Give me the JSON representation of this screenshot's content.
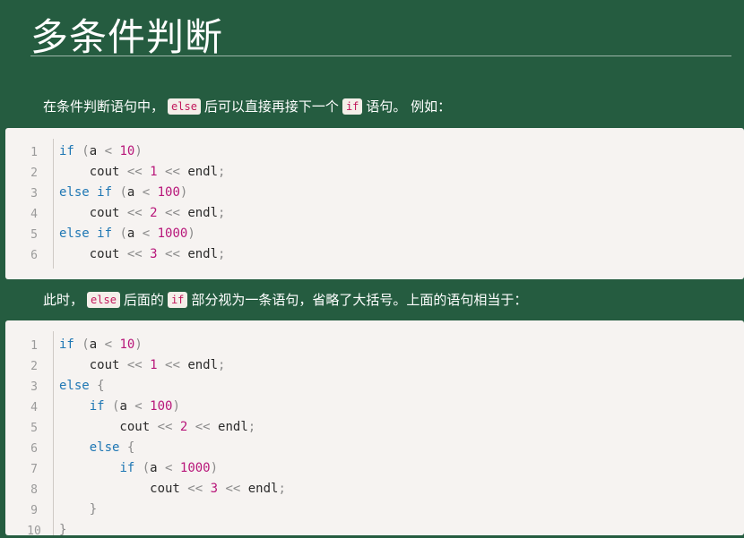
{
  "page": {
    "title": "多条件判断"
  },
  "para1": {
    "before": "在条件判断语句中，",
    "kw1": "else",
    "middle": "后可以直接再接下一个",
    "kw2": "if",
    "after": "语句。 例如："
  },
  "para2": {
    "before": "此时，",
    "kw1": "else",
    "middle": "后面的",
    "kw2": "if",
    "after": "部分视为一条语句，省略了大括号。上面的语句相当于："
  },
  "code1": {
    "line_numbers": [
      "1",
      "2",
      "3",
      "4",
      "5",
      "6"
    ],
    "lines": [
      [
        {
          "t": "if",
          "c": "k"
        },
        {
          "t": " (",
          "c": "p"
        },
        {
          "t": "a",
          "c": "t"
        },
        {
          "t": " < ",
          "c": "p"
        },
        {
          "t": "10",
          "c": "n"
        },
        {
          "t": ")",
          "c": "p"
        }
      ],
      [
        {
          "t": "    cout",
          "c": "t"
        },
        {
          "t": " << ",
          "c": "p"
        },
        {
          "t": "1",
          "c": "n"
        },
        {
          "t": " << ",
          "c": "p"
        },
        {
          "t": "endl",
          "c": "t"
        },
        {
          "t": ";",
          "c": "p"
        }
      ],
      [
        {
          "t": "else if",
          "c": "k"
        },
        {
          "t": " (",
          "c": "p"
        },
        {
          "t": "a",
          "c": "t"
        },
        {
          "t": " < ",
          "c": "p"
        },
        {
          "t": "100",
          "c": "n"
        },
        {
          "t": ")",
          "c": "p"
        }
      ],
      [
        {
          "t": "    cout",
          "c": "t"
        },
        {
          "t": " << ",
          "c": "p"
        },
        {
          "t": "2",
          "c": "n"
        },
        {
          "t": " << ",
          "c": "p"
        },
        {
          "t": "endl",
          "c": "t"
        },
        {
          "t": ";",
          "c": "p"
        }
      ],
      [
        {
          "t": "else if",
          "c": "k"
        },
        {
          "t": " (",
          "c": "p"
        },
        {
          "t": "a",
          "c": "t"
        },
        {
          "t": " < ",
          "c": "p"
        },
        {
          "t": "1000",
          "c": "n"
        },
        {
          "t": ")",
          "c": "p"
        }
      ],
      [
        {
          "t": "    cout",
          "c": "t"
        },
        {
          "t": " << ",
          "c": "p"
        },
        {
          "t": "3",
          "c": "n"
        },
        {
          "t": " << ",
          "c": "p"
        },
        {
          "t": "endl",
          "c": "t"
        },
        {
          "t": ";",
          "c": "p"
        }
      ]
    ]
  },
  "code2": {
    "line_numbers": [
      "1",
      "2",
      "3",
      "4",
      "5",
      "6",
      "7",
      "8",
      "9",
      "10"
    ],
    "lines": [
      [
        {
          "t": "if",
          "c": "k"
        },
        {
          "t": " (",
          "c": "p"
        },
        {
          "t": "a",
          "c": "t"
        },
        {
          "t": " < ",
          "c": "p"
        },
        {
          "t": "10",
          "c": "n"
        },
        {
          "t": ")",
          "c": "p"
        }
      ],
      [
        {
          "t": "    cout",
          "c": "t"
        },
        {
          "t": " << ",
          "c": "p"
        },
        {
          "t": "1",
          "c": "n"
        },
        {
          "t": " << ",
          "c": "p"
        },
        {
          "t": "endl",
          "c": "t"
        },
        {
          "t": ";",
          "c": "p"
        }
      ],
      [
        {
          "t": "else",
          "c": "k"
        },
        {
          "t": " {",
          "c": "p"
        }
      ],
      [
        {
          "t": "    ",
          "c": "t"
        },
        {
          "t": "if",
          "c": "k"
        },
        {
          "t": " (",
          "c": "p"
        },
        {
          "t": "a",
          "c": "t"
        },
        {
          "t": " < ",
          "c": "p"
        },
        {
          "t": "100",
          "c": "n"
        },
        {
          "t": ")",
          "c": "p"
        }
      ],
      [
        {
          "t": "        cout",
          "c": "t"
        },
        {
          "t": " << ",
          "c": "p"
        },
        {
          "t": "2",
          "c": "n"
        },
        {
          "t": " << ",
          "c": "p"
        },
        {
          "t": "endl",
          "c": "t"
        },
        {
          "t": ";",
          "c": "p"
        }
      ],
      [
        {
          "t": "    ",
          "c": "t"
        },
        {
          "t": "else",
          "c": "k"
        },
        {
          "t": " {",
          "c": "p"
        }
      ],
      [
        {
          "t": "        ",
          "c": "t"
        },
        {
          "t": "if",
          "c": "k"
        },
        {
          "t": " (",
          "c": "p"
        },
        {
          "t": "a",
          "c": "t"
        },
        {
          "t": " < ",
          "c": "p"
        },
        {
          "t": "1000",
          "c": "n"
        },
        {
          "t": ")",
          "c": "p"
        }
      ],
      [
        {
          "t": "            cout",
          "c": "t"
        },
        {
          "t": " << ",
          "c": "p"
        },
        {
          "t": "3",
          "c": "n"
        },
        {
          "t": " << ",
          "c": "p"
        },
        {
          "t": "endl",
          "c": "t"
        },
        {
          "t": ";",
          "c": "p"
        }
      ],
      [
        {
          "t": "    }",
          "c": "p"
        }
      ],
      [
        {
          "t": "}",
          "c": "p"
        }
      ]
    ]
  }
}
